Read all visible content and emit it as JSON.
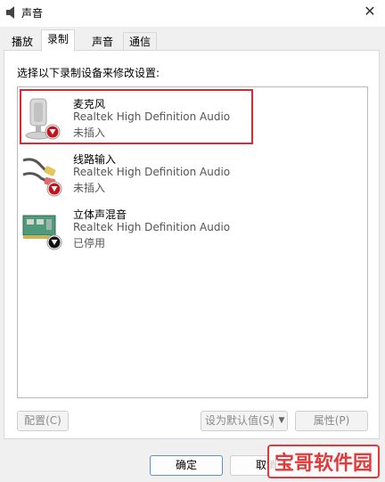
{
  "window": {
    "title": "声音",
    "close_glyph": "✕"
  },
  "tabs": [
    {
      "label": "播放"
    },
    {
      "label": "录制"
    },
    {
      "label": "声音"
    },
    {
      "label": "通信"
    }
  ],
  "active_tab": "录制",
  "panel": {
    "instruction": "选择以下录制设备来修改设置:",
    "devices": [
      {
        "name": "麦克风",
        "driver": "Realtek High Definition Audio",
        "status": "未插入",
        "icon": "microphone-icon",
        "badge": "red-down-arrow-badge",
        "highlighted": true
      },
      {
        "name": "线路输入",
        "driver": "Realtek High Definition Audio",
        "status": "未插入",
        "icon": "line-in-cable-icon",
        "badge": "red-down-arrow-badge",
        "highlighted": false
      },
      {
        "name": "立体声混音",
        "driver": "Realtek High Definition Audio",
        "status": "已停用",
        "icon": "sound-card-icon",
        "badge": "black-down-arrow-badge",
        "highlighted": false
      }
    ]
  },
  "buttons": {
    "configure": "配置(C)",
    "set_default": "设为默认值(S)",
    "properties": "属性(P)",
    "ok": "确定",
    "cancel": "取消"
  },
  "watermark": {
    "text": "宝哥软件园"
  },
  "colors": {
    "highlight_border": "#d22b3a",
    "badge_red": "#c4151c",
    "ok_border": "#5c8fd6",
    "watermark": "#e23a3a"
  }
}
